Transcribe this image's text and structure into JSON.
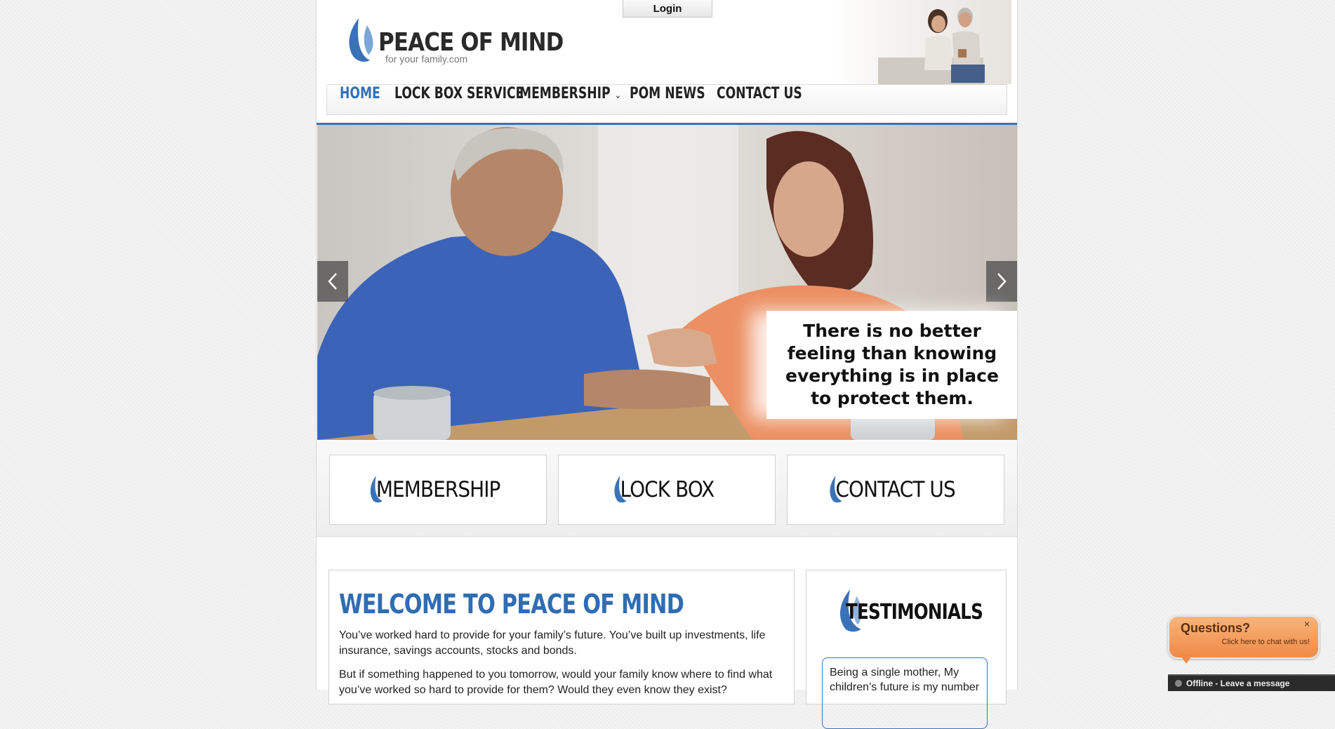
{
  "header": {
    "login_label": "Login",
    "logo_title": "PEACE OF MIND",
    "logo_subtitle": "for your family.com"
  },
  "nav": {
    "items": [
      {
        "label": "HOME",
        "active": true
      },
      {
        "label": "LOCK BOX SERVICE",
        "active": false
      },
      {
        "label": "MEMBERSHIP",
        "active": false,
        "has_dropdown": true
      },
      {
        "label": "POM NEWS",
        "active": false
      },
      {
        "label": "CONTACT US",
        "active": false
      }
    ]
  },
  "hero": {
    "quote": "There is no better feeling than knowing everything is in place to protect them.",
    "prev_icon": "chevron-left-icon",
    "next_icon": "chevron-right-icon"
  },
  "features": [
    {
      "label": "MEMBERSHIP"
    },
    {
      "label": "LOCK BOX"
    },
    {
      "label": "CONTACT US"
    }
  ],
  "welcome": {
    "title": "WELCOME TO PEACE OF MIND",
    "para1": "You’ve worked hard to provide for your family’s future. You’ve built up investments, life insurance, savings accounts, stocks and bonds.",
    "para2": "But if something happened to you tomorrow, would your family know where to find what you’ve worked so hard to provide for them? Would they even know they exist?"
  },
  "testimonials": {
    "title": "TESTIMONIALS",
    "quote": "Being a single mother, My children’s future is my number"
  },
  "chat": {
    "title": "Questions?",
    "subtitle": "Click here to chat with us!",
    "close": "×",
    "offline": "Offline - Leave a message"
  },
  "colors": {
    "brand_blue": "#3370b7",
    "chat_orange": "#f18a47",
    "nav_text": "#222222"
  }
}
